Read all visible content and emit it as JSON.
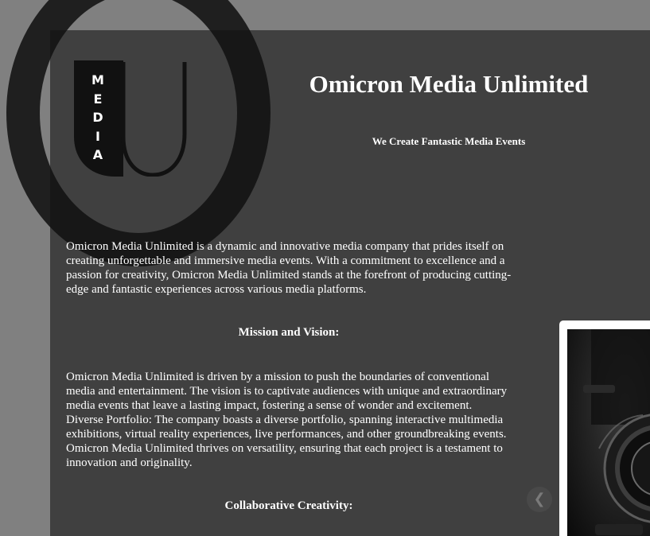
{
  "brand": {
    "logo_letters": [
      "M",
      "E",
      "D",
      "I",
      "A"
    ],
    "watermark_letter": "O"
  },
  "header": {
    "title": "Omicron Media Unlimited",
    "tagline": "We Create Fantastic Media Events"
  },
  "main": {
    "intro": "Omicron Media Unlimited is a dynamic and innovative media company that prides itself on creating unforgettable and immersive media events. With a commitment to excellence and a passion for creativity, Omicron Media Unlimited stands at the forefront of producing cutting-edge and fantastic experiences across various media platforms.",
    "mission_heading": "Mission and Vision:",
    "mission_text": "Omicron Media Unlimited is driven by a mission to push the boundaries of conventional media and entertainment. The vision is to captivate audiences with unique and extraordinary media events that leave a lasting impact, fostering a sense of wonder and excitement. Diverse Portfolio: The company boasts a diverse portfolio, spanning interactive multimedia exhibitions, virtual reality experiences, live performances, and other groundbreaking events. Omicron Media Unlimited thrives on versatility, ensuring that each project is a testament to innovation and originality.",
    "collab_heading": "Collaborative Creativity:"
  },
  "slider": {
    "prev_label": "❮"
  },
  "colors": {
    "page_background": "#808080",
    "panel_background": "#404040",
    "text": "#ffffff",
    "logo_fill": "#111111"
  },
  "icons": {
    "prev": "chevron-left-icon",
    "logo": "media-u-logo-icon"
  }
}
